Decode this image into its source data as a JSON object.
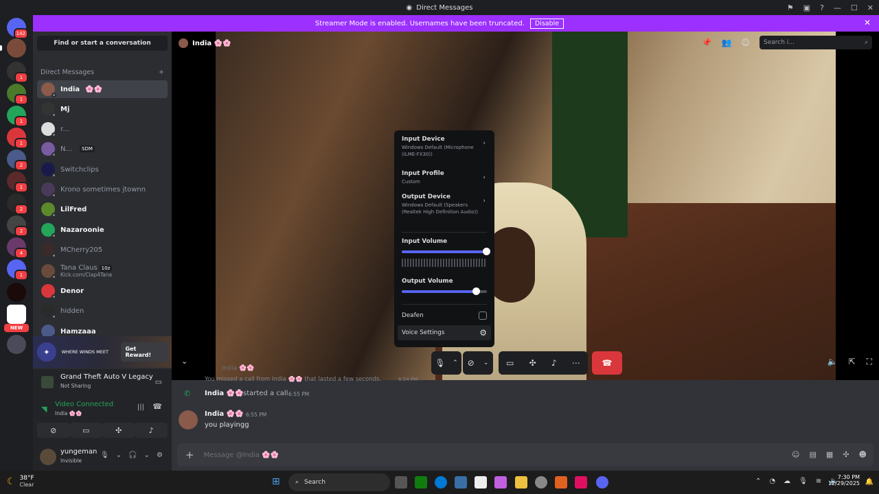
{
  "window": {
    "title": "Direct Messages"
  },
  "banner": {
    "text": "Streamer Mode is enabled. Usernames have been truncated.",
    "button": "Disable"
  },
  "guilds": {
    "home_badge": "142",
    "badges": [
      "1",
      "1",
      "1",
      "1",
      "2",
      "1",
      "2",
      "2",
      "1",
      "4",
      "1"
    ],
    "new_label": "NEW"
  },
  "dms": {
    "search": "Find or start a conversation",
    "header": "Direct Messages",
    "items": [
      {
        "name": "India",
        "emoji": "🌸🌸"
      },
      {
        "name": "Mj"
      },
      {
        "name": "r..."
      },
      {
        "name": "N...",
        "tag": "SDM"
      },
      {
        "name": "Switchclips"
      },
      {
        "name": "Krono sometimes jtownn"
      },
      {
        "name": "LilFred"
      },
      {
        "name": "Nazaroonie"
      },
      {
        "name": "MCherry205"
      },
      {
        "name": "Tana Claus",
        "tag": "10z",
        "sub": "Kick.com/Clap4Tana"
      },
      {
        "name": "Denor"
      },
      {
        "name": "hidden"
      },
      {
        "name": "Hamzaaa"
      }
    ]
  },
  "promo": {
    "text": "WHERE WINDS MEET",
    "button": "Get Reward!"
  },
  "activity": {
    "game": "Grand Theft Auto V Legacy",
    "status": "Not Sharing"
  },
  "voice": {
    "status": "Video Connected",
    "channel": "India 🌸🌸"
  },
  "user": {
    "name": "yungeman",
    "status": "Invisible"
  },
  "stage": {
    "name": "India 🌸🌸",
    "search_placeholder": "Search i..."
  },
  "popup": {
    "input_device": "Input Device",
    "input_device_value": "Windows Default (Microphone (ILME-FX30))",
    "input_profile": "Input Profile",
    "input_profile_value": "Custom",
    "output_device": "Output Device",
    "output_device_value": "Windows Default (Speakers (Realtek High Definition Audio))",
    "input_volume": "Input Volume",
    "input_volume_level": 1.0,
    "output_volume": "Output Volume",
    "output_volume_level": 0.88,
    "deafen": "Deafen",
    "voice_settings": "Voice Settings"
  },
  "chat": {
    "missed_call": "You missed a call from India 🌸🌸 that lasted a few seconds.",
    "missed_time": "6:54 PM",
    "call_user": "India 🌸🌸",
    "call_text": "started a call.",
    "call_time": "6:55 PM",
    "msg_user": "India 🌸🌸",
    "msg_time": "6:55 PM",
    "msg_text": "you playingg",
    "placeholder": "Message @India 🌸🌸",
    "overlay_name": "India 🌸🌸"
  },
  "taskbar": {
    "weather_temp": "38°F",
    "weather_cond": "Clear",
    "search": "Search",
    "time": "7:30 PM",
    "date": "12/29/2025"
  },
  "colors": {
    "accent": "#5865f2",
    "banner": "#9b30ff",
    "danger": "#da373c",
    "online": "#23a55a"
  }
}
